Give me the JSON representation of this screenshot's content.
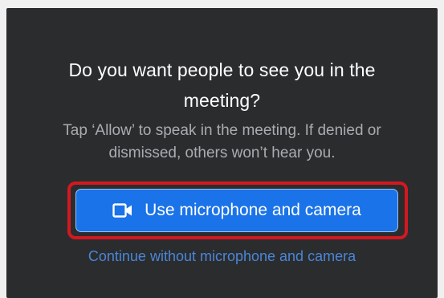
{
  "dialog": {
    "title": "Do you want people to see you in the meeting?",
    "subtitle": "Tap ‘Allow’ to speak in the meeting. If denied or dismissed, others won’t hear you.",
    "primary_button": {
      "label": "Use microphone and camera",
      "icon": "video-camera-icon"
    },
    "secondary_link": "Continue without microphone and camera"
  },
  "colors": {
    "dialog_background": "#2b2c2e",
    "primary_button": "#1a73e8",
    "highlight_border": "#d41820",
    "link": "#4a86d8"
  }
}
